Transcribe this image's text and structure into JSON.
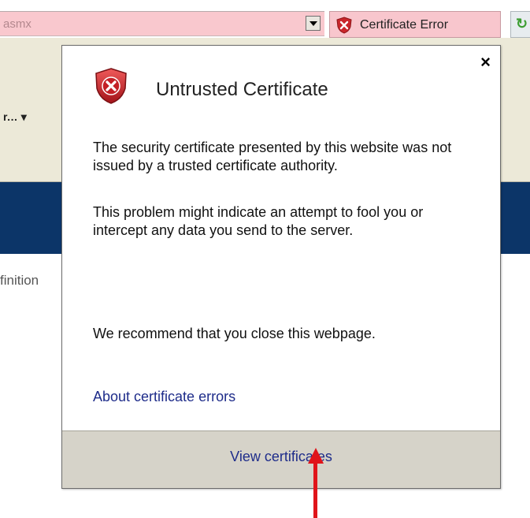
{
  "address_bar": {
    "url_fragment": "asmx"
  },
  "security_tab": {
    "label": "Certificate Error",
    "icon": "shield-x-icon"
  },
  "toolbar": {
    "menu_fragment": "r... ▾"
  },
  "page": {
    "side_text": "finition"
  },
  "popup": {
    "title": "Untrusted Certificate",
    "icon": "shield-x-icon",
    "close_label": "×",
    "paragraph_1": "The security certificate presented by this website was not issued by a trusted certificate authority.",
    "paragraph_2": "This problem might indicate an attempt to fool you or intercept any data you send to the server.",
    "paragraph_3": "We recommend that you close this webpage.",
    "help_link": "About certificate errors",
    "footer_button": "View certificates"
  },
  "colors": {
    "error_pink": "#f8c6cd",
    "link_blue": "#1e2c8a",
    "arrow_red": "#e0141a",
    "nav_band": "#0c3568"
  }
}
